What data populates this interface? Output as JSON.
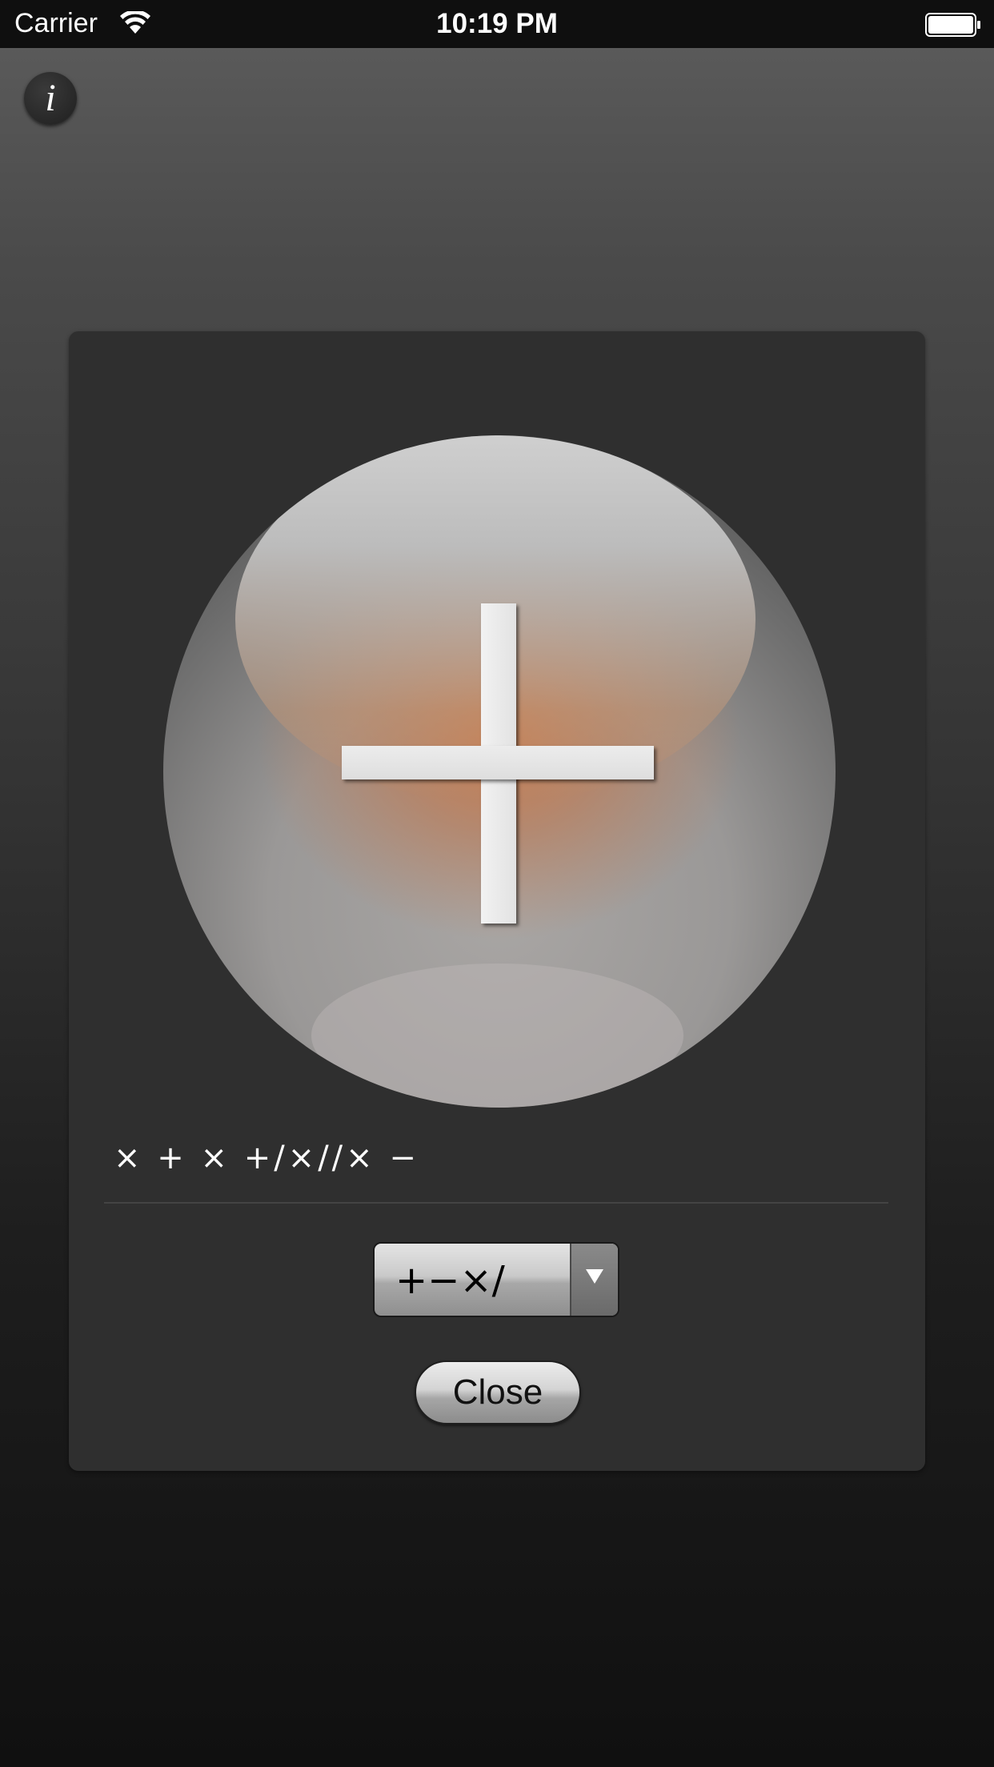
{
  "status_bar": {
    "carrier": "Carrier",
    "time": "10:19 PM",
    "wifi_icon": "wifi-icon",
    "battery_icon": "battery-icon"
  },
  "info_button": {
    "label": "i",
    "icon": "info-icon"
  },
  "panel": {
    "display_operator": "+",
    "sequence": "× + × +/×//× −",
    "operator_select": {
      "selected": "+−×/"
    },
    "close_label": "Close"
  },
  "colors": {
    "background_top": "#5d5d5d",
    "background_bottom": "#101010",
    "panel": "#2f2f2f",
    "sphere_glow": "#cd7846"
  }
}
